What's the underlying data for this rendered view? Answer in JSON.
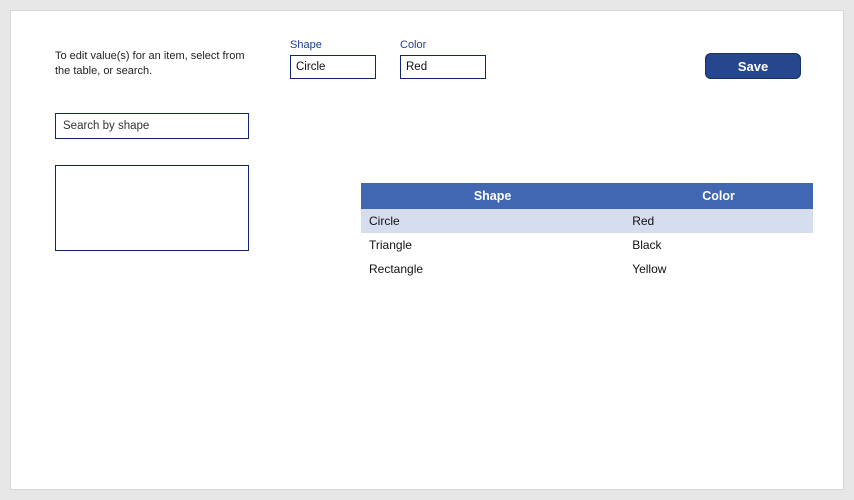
{
  "instructions": "To edit value(s) for an item, select from the table, or search.",
  "fields": {
    "shape": {
      "label": "Shape",
      "value": "Circle"
    },
    "color": {
      "label": "Color",
      "value": "Red"
    }
  },
  "save_label": "Save",
  "search": {
    "placeholder": "Search by shape",
    "value": ""
  },
  "table": {
    "headers": {
      "shape": "Shape",
      "color": "Color"
    },
    "rows": [
      {
        "shape": "Circle",
        "color": "Red",
        "selected": true
      },
      {
        "shape": "Triangle",
        "color": "Black",
        "selected": false
      },
      {
        "shape": "Rectangle",
        "color": "Yellow",
        "selected": false
      }
    ]
  }
}
